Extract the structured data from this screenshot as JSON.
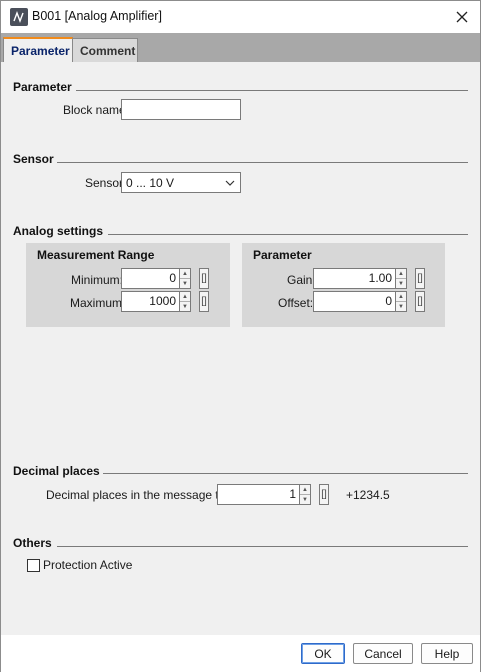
{
  "window": {
    "title": "B001 [Analog Amplifier]",
    "icon": "analog-amplifier-block-icon",
    "close_icon": "close-icon"
  },
  "tabs": [
    {
      "label": "Parameter",
      "active": true
    },
    {
      "label": "Comment",
      "active": false
    }
  ],
  "parameter_section": {
    "title": "Parameter",
    "block_name_label": "Block name:",
    "block_name_value": ""
  },
  "sensor_section": {
    "title": "Sensor",
    "sensor_label": "Sensor:",
    "sensor_value": "0 ... 10 V"
  },
  "analog_settings": {
    "title": "Analog settings",
    "measurement_range": {
      "title": "Measurement Range",
      "minimum_label": "Minimum:",
      "minimum_value": "0",
      "maximum_label": "Maximum:",
      "maximum_value": "1000"
    },
    "parameter": {
      "title": "Parameter",
      "gain_label": "Gain:",
      "gain_value": "1.00",
      "offset_label": "Offset:",
      "offset_value": "0"
    }
  },
  "decimal_places": {
    "title": "Decimal places",
    "label": "Decimal places in the message text:",
    "value": "1",
    "preview": "+1234.5"
  },
  "others": {
    "title": "Others",
    "protection_label": "Protection Active",
    "protection_checked": false
  },
  "buttons": {
    "ok": "OK",
    "cancel": "Cancel",
    "help": "Help"
  },
  "param_button_glyph": "[]",
  "colors": {
    "active_tab_accent": "#f18b1c",
    "active_tab_text": "#0a246a",
    "groupbox_bg": "#d7d7d7",
    "default_button_border": "#2f6ac9"
  }
}
